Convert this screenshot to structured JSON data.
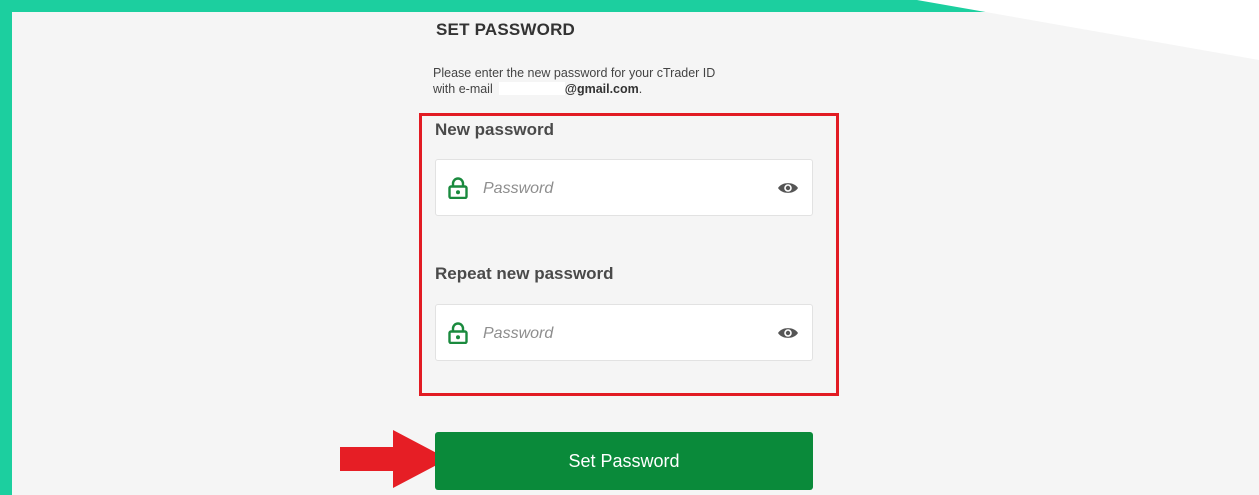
{
  "page": {
    "title": "SET PASSWORD",
    "description_line1": "Please enter the new password for your cTrader ID",
    "description_prefix": "with e-mail",
    "email_domain": "@gmail.com",
    "description_suffix": "."
  },
  "form": {
    "new_password": {
      "label": "New password",
      "placeholder": "Password",
      "value": ""
    },
    "repeat_password": {
      "label": "Repeat new password",
      "placeholder": "Password",
      "value": ""
    },
    "submit_label": "Set Password"
  },
  "icons": {
    "lock": "lock-icon",
    "eye": "eye-icon",
    "arrow": "red-arrow-icon"
  },
  "colors": {
    "accent_border": "#1ccf9f",
    "button": "#0a8a3a",
    "lock_icon": "#1a8a3e",
    "highlight": "#e21b23"
  }
}
